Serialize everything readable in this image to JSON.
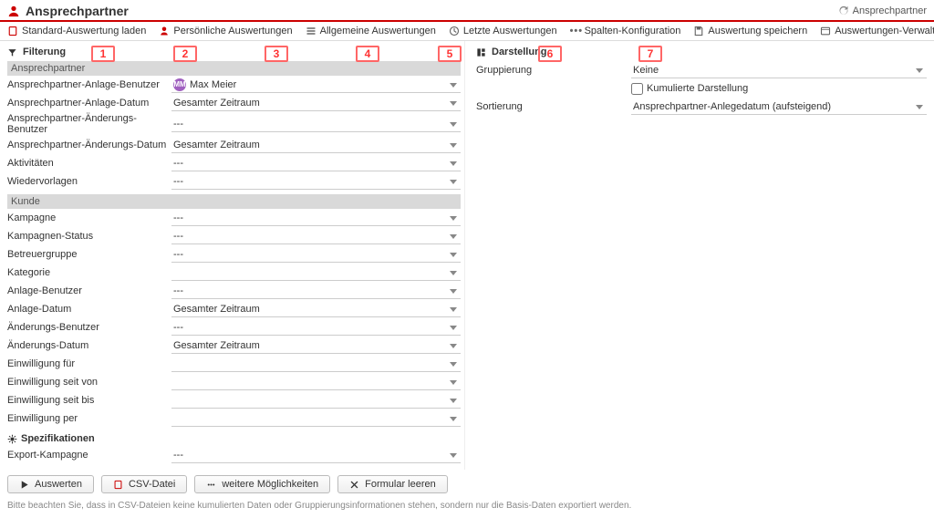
{
  "header": {
    "title": "Ansprechpartner",
    "breadcrumb": "Ansprechpartner"
  },
  "toolbar": {
    "load_standard": "Standard-Auswertung laden",
    "personal": "Persönliche Auswertungen",
    "general": "Allgemeine Auswertungen",
    "recent": "Letzte Auswertungen",
    "columns": "Spalten-Konfiguration",
    "save": "Auswertung speichern",
    "manage": "Auswertungen-Verwaltung"
  },
  "markers": [
    "1",
    "2",
    "3",
    "4",
    "5",
    "6",
    "7"
  ],
  "filter": {
    "heading": "Filterung",
    "group_ansprechpartner": "Ansprechpartner",
    "fields_ap": {
      "anlage_benutzer": {
        "label": "Ansprechpartner-Anlage-Benutzer",
        "value": "Max Meier",
        "avatar": "MM"
      },
      "anlage_datum": {
        "label": "Ansprechpartner-Anlage-Datum",
        "value": "Gesamter Zeitraum"
      },
      "aender_benutzer": {
        "label": "Ansprechpartner-Änderungs-Benutzer",
        "value": "---"
      },
      "aender_datum": {
        "label": "Ansprechpartner-Änderungs-Datum",
        "value": "Gesamter Zeitraum"
      },
      "aktivitaeten": {
        "label": "Aktivitäten",
        "value": "---"
      },
      "wiedervorlagen": {
        "label": "Wiedervorlagen",
        "value": "---"
      }
    },
    "group_kunde": "Kunde",
    "fields_kunde": {
      "kampagne": {
        "label": "Kampagne",
        "value": "---"
      },
      "kampagne_status": {
        "label": "Kampagnen-Status",
        "value": "---"
      },
      "betreuergruppe": {
        "label": "Betreuergruppe",
        "value": "---"
      },
      "kategorie": {
        "label": "Kategorie",
        "value": ""
      },
      "anlage_benutzer": {
        "label": "Anlage-Benutzer",
        "value": "---"
      },
      "anlage_datum": {
        "label": "Anlage-Datum",
        "value": "Gesamter Zeitraum"
      },
      "aender_benutzer": {
        "label": "Änderungs-Benutzer",
        "value": "---"
      },
      "aender_datum": {
        "label": "Änderungs-Datum",
        "value": "Gesamter Zeitraum"
      },
      "einw_fuer": {
        "label": "Einwilligung für",
        "value": ""
      },
      "einw_seit_von": {
        "label": "Einwilligung seit von",
        "value": ""
      },
      "einw_seit_bis": {
        "label": "Einwilligung seit bis",
        "value": ""
      },
      "einw_per": {
        "label": "Einwilligung per",
        "value": ""
      }
    },
    "spec_heading": "Spezifikationen",
    "spec": {
      "export_kampagne": {
        "label": "Export-Kampagne",
        "value": "---"
      }
    }
  },
  "display": {
    "heading": "Darstellung",
    "group_label": "Gruppierung",
    "group_value": "Keine",
    "cumulative_label": "Kumulierte Darstellung",
    "cumulative_checked": false,
    "sort_label": "Sortierung",
    "sort_value": "Ansprechpartner-Anlegedatum (aufsteigend)"
  },
  "buttons": {
    "eval": "Auswerten",
    "csv": "CSV-Datei",
    "more": "weitere Möglichkeiten",
    "clear": "Formular leeren"
  },
  "footnote": "Bitte beachten Sie, dass in CSV-Dateien keine kumulierten Daten oder Gruppierungsinformationen stehen, sondern nur die Basis-Daten exportiert werden."
}
